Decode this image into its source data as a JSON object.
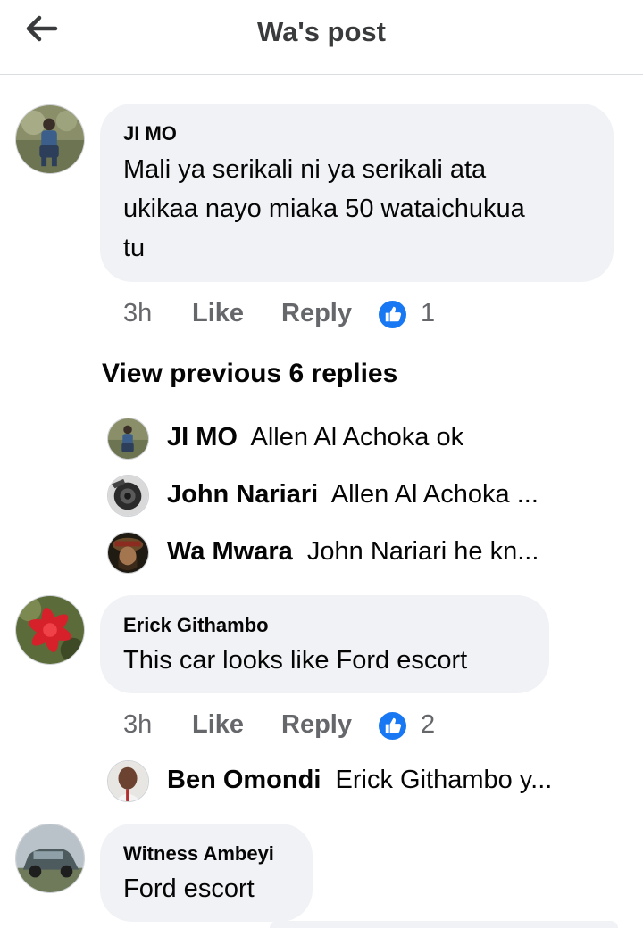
{
  "header": {
    "title": "Wa's post",
    "back_icon": "arrow-left-icon"
  },
  "colors": {
    "like_blue": "#1877f2",
    "bubble_bg": "#f0f2f5",
    "meta_grey": "#65676b"
  },
  "comments": [
    {
      "author": "JI MO",
      "lines": [
        "Mali ya serikali ni ya serikali ata",
        "ukikaa nayo miaka 50 wataichukua",
        "tu"
      ],
      "time": "3h",
      "like": "Like",
      "reply": "Reply",
      "reactions": "1"
    },
    {
      "author": "Erick Githambo",
      "lines": [
        "This car looks like Ford escort"
      ],
      "time": "3h",
      "like": "Like",
      "reply": "Reply",
      "reactions": "2"
    },
    {
      "author": "Witness Ambeyi",
      "lines": [
        "Ford escort"
      ]
    }
  ],
  "view_previous": "View previous 6 replies",
  "replies": [
    {
      "name": "JI MO",
      "text": "Allen Al Achoka ok"
    },
    {
      "name": "John Nariari",
      "text": "Allen Al Achoka ..."
    },
    {
      "name": "Wa Mwara",
      "text": "John Nariari  he kn..."
    },
    {
      "name": "Ben Omondi",
      "text": "Erick Githambo y..."
    }
  ]
}
